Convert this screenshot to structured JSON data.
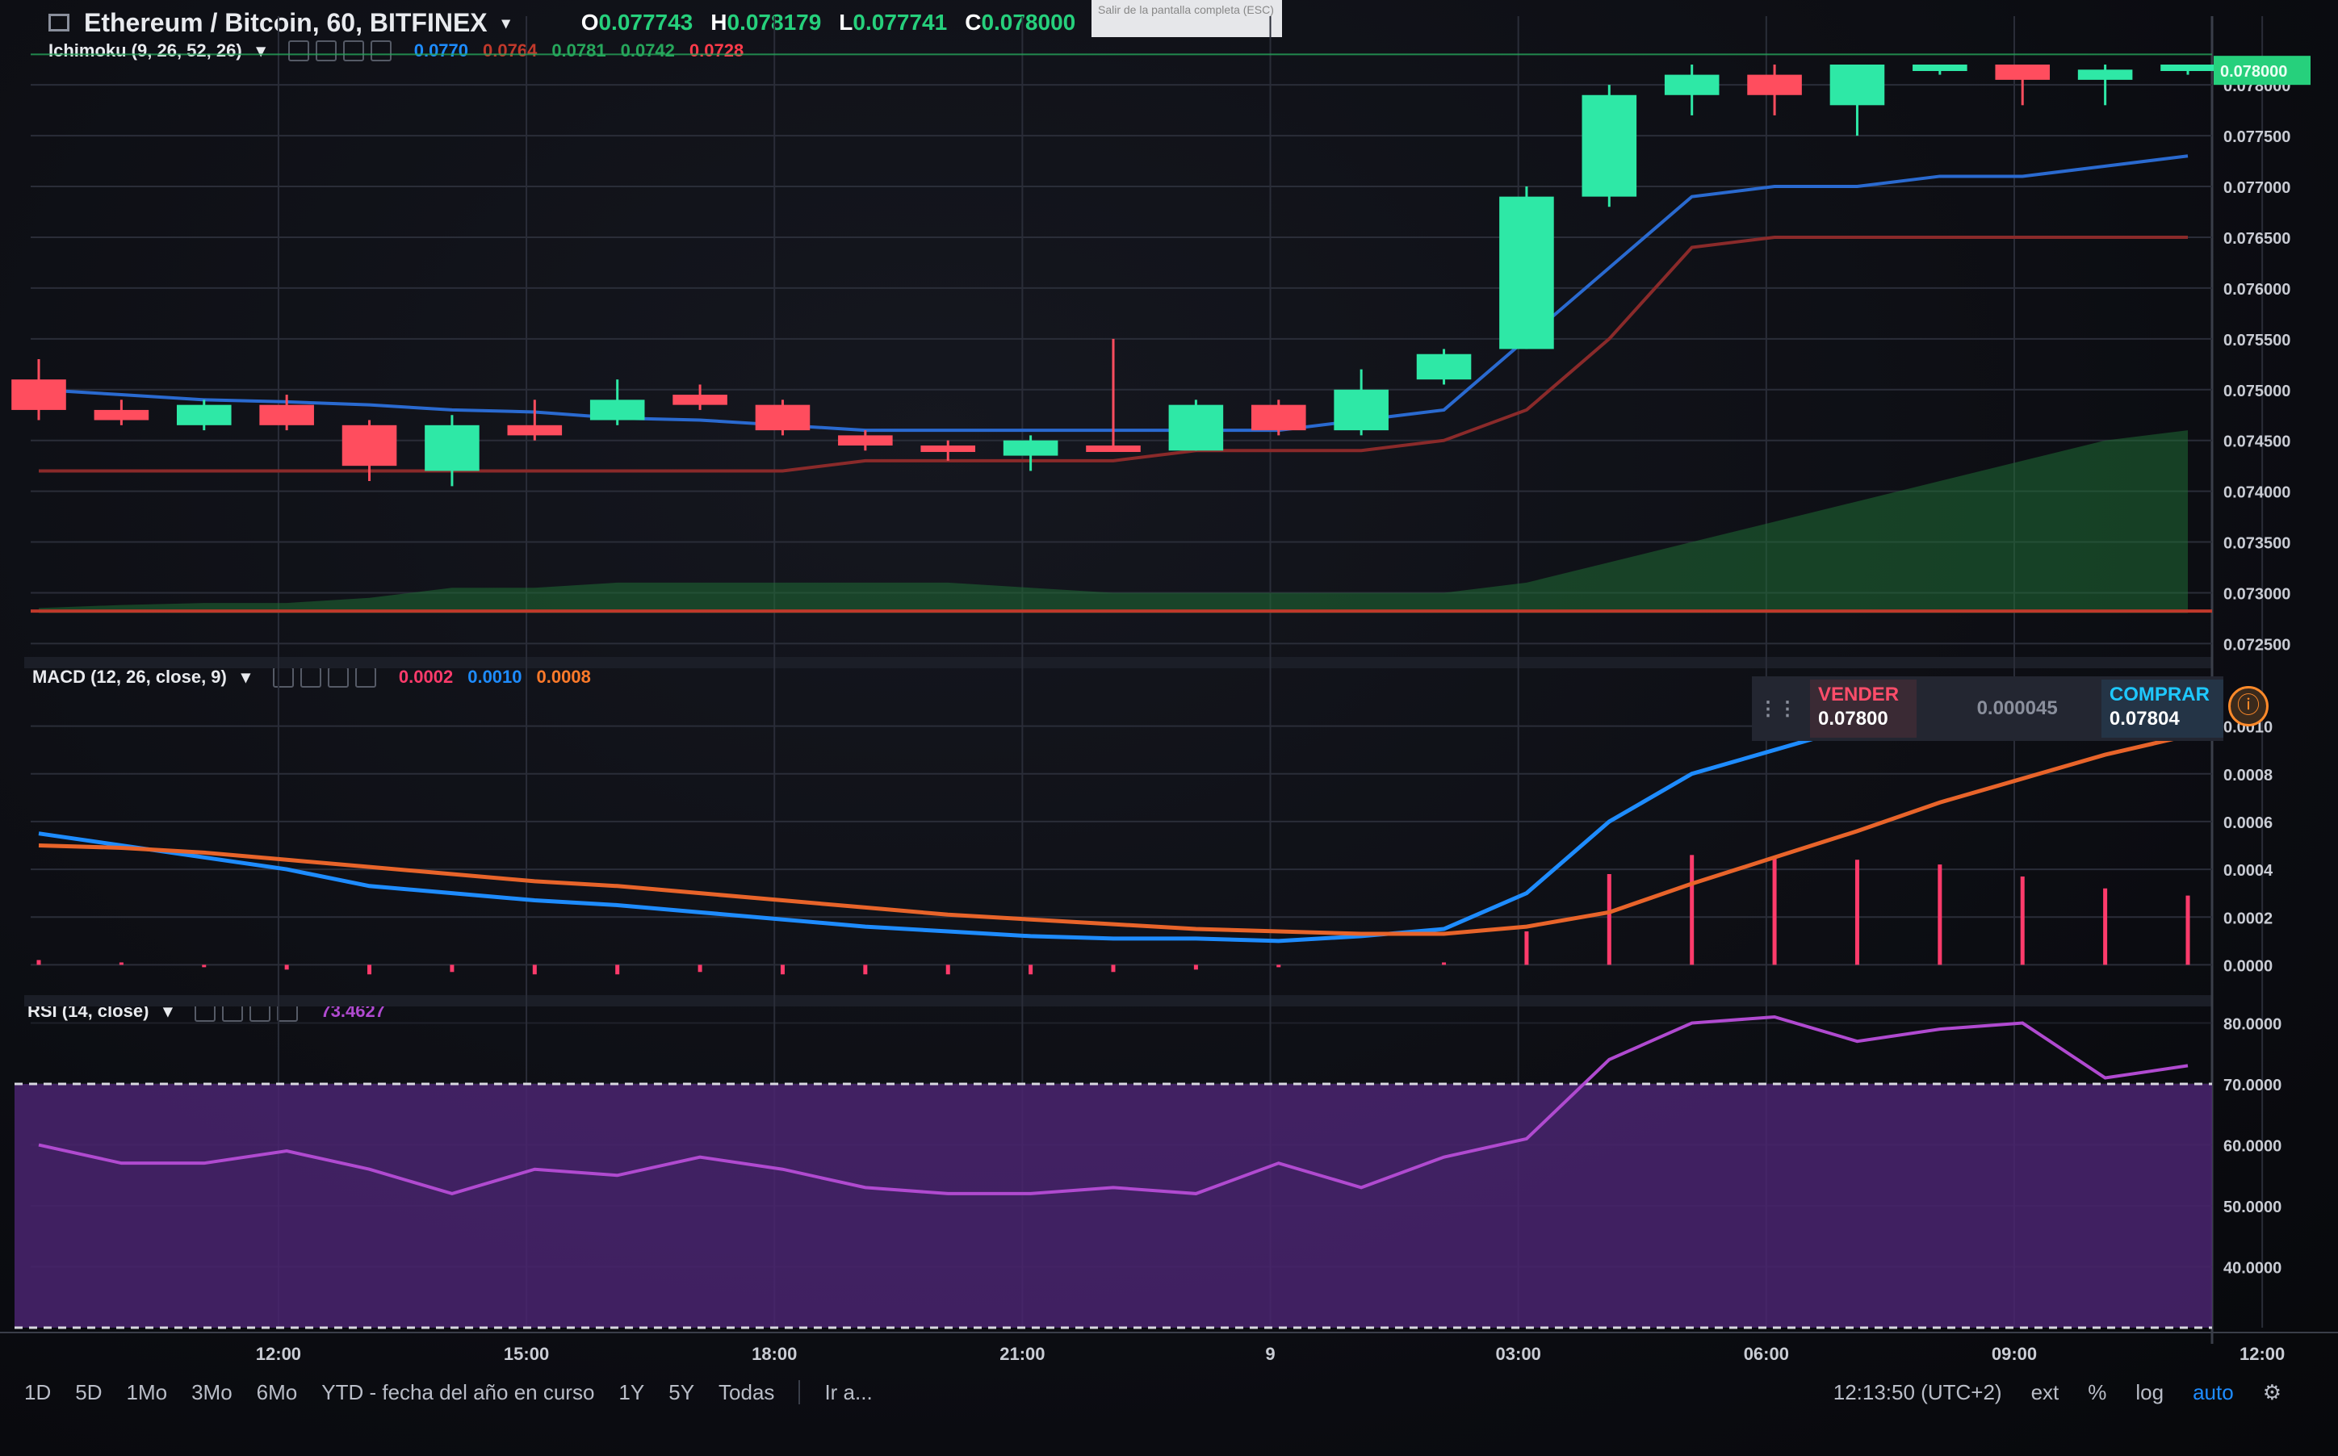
{
  "header": {
    "symbol_title": "Ethereum / Bitcoin, 60, BITFINEX",
    "ohlc": [
      {
        "key": "O",
        "value": "0.077743"
      },
      {
        "key": "H",
        "value": "0.078179"
      },
      {
        "key": "L",
        "value": "0.077741"
      },
      {
        "key": "C",
        "value": "0.078000"
      }
    ],
    "tooltip_text": "Salir de la pantalla completa (ESC)"
  },
  "ichimoku": {
    "label": "Ichimoku (9, 26, 52, 26)",
    "values": [
      {
        "text": "0.0770",
        "color": "#1e8cff"
      },
      {
        "text": "0.0764",
        "color": "#c0392b"
      },
      {
        "text": "0.0781",
        "color": "#26a65b"
      },
      {
        "text": "0.0742",
        "color": "#26a65b"
      },
      {
        "text": "0.0728",
        "color": "#ff3b4a"
      }
    ]
  },
  "macd": {
    "label": "MACD (12, 26, close, 9)",
    "values": [
      {
        "text": "0.0002",
        "color": "#ff3b6b"
      },
      {
        "text": "0.0010",
        "color": "#1e8cff"
      },
      {
        "text": "0.0008",
        "color": "#ff7a2a"
      }
    ]
  },
  "rsi": {
    "label": "RSI (14, close)",
    "value": "73.4627",
    "value_color": "#b04ad0"
  },
  "trade_panel": {
    "sell_label": "VENDER",
    "sell_price": "0.07800",
    "spread": "0.000045",
    "buy_label": "COMPRAR",
    "buy_price": "0.07804"
  },
  "toolbar": {
    "ranges": [
      "1D",
      "5D",
      "1Mo",
      "3Mo",
      "6Mo",
      "YTD - fecha del año en curso",
      "1Y",
      "5Y",
      "Todas"
    ],
    "goto": "Ir a...",
    "clock": "12:13:50 (UTC+2)",
    "right_buttons": [
      "ext",
      "%",
      "log",
      "auto"
    ],
    "active_button": "auto"
  },
  "colors": {
    "up": "#2ee8a6",
    "down": "#ff4d5e",
    "tenkan": "#2a6ad0",
    "kijun": "#8a2a2a",
    "cloud": "#1f6b35",
    "macd_line": "#1e8cff",
    "signal_line": "#e8642a",
    "histogram": "#ff3b6b",
    "rsi_line": "#b04ad0",
    "rsi_fill": "#4a2470"
  },
  "chart_data": [
    {
      "type": "candlestick",
      "title": "Ethereum / Bitcoin, 60, BITFINEX",
      "x_tick_labels": [
        "12:00",
        "15:00",
        "18:00",
        "21:00",
        "9",
        "03:00",
        "06:00",
        "09:00",
        "12:00"
      ],
      "y_tick_labels": [
        "0.078000",
        "0.077500",
        "0.077000",
        "0.076500",
        "0.076000",
        "0.075500",
        "0.075000",
        "0.074500",
        "0.074000",
        "0.073500",
        "0.073000",
        "0.072500"
      ],
      "ylim": [
        0.0724,
        0.0782
      ],
      "current_price_label": "0.078000",
      "candles": [
        {
          "o": 0.0751,
          "h": 0.0753,
          "l": 0.0747,
          "c": 0.0748
        },
        {
          "o": 0.0748,
          "h": 0.0749,
          "l": 0.07465,
          "c": 0.0747
        },
        {
          "o": 0.07465,
          "h": 0.0749,
          "l": 0.0746,
          "c": 0.07485
        },
        {
          "o": 0.07485,
          "h": 0.07495,
          "l": 0.0746,
          "c": 0.07465
        },
        {
          "o": 0.07465,
          "h": 0.0747,
          "l": 0.0741,
          "c": 0.07425
        },
        {
          "o": 0.0742,
          "h": 0.07475,
          "l": 0.07405,
          "c": 0.07465
        },
        {
          "o": 0.07465,
          "h": 0.0749,
          "l": 0.0745,
          "c": 0.07455
        },
        {
          "o": 0.0747,
          "h": 0.0751,
          "l": 0.07465,
          "c": 0.0749
        },
        {
          "o": 0.07495,
          "h": 0.07505,
          "l": 0.0748,
          "c": 0.07485
        },
        {
          "o": 0.07485,
          "h": 0.0749,
          "l": 0.07455,
          "c": 0.0746
        },
        {
          "o": 0.07455,
          "h": 0.0746,
          "l": 0.0744,
          "c": 0.07445
        },
        {
          "o": 0.07445,
          "h": 0.0745,
          "l": 0.0743,
          "c": 0.0744
        },
        {
          "o": 0.07435,
          "h": 0.07455,
          "l": 0.0742,
          "c": 0.0745
        },
        {
          "o": 0.07445,
          "h": 0.0755,
          "l": 0.0744,
          "c": 0.0744
        },
        {
          "o": 0.0744,
          "h": 0.0749,
          "l": 0.0744,
          "c": 0.07485
        },
        {
          "o": 0.07485,
          "h": 0.0749,
          "l": 0.07455,
          "c": 0.0746
        },
        {
          "o": 0.0746,
          "h": 0.0752,
          "l": 0.07455,
          "c": 0.075
        },
        {
          "o": 0.0751,
          "h": 0.0754,
          "l": 0.07505,
          "c": 0.07535
        },
        {
          "o": 0.0754,
          "h": 0.077,
          "l": 0.0754,
          "c": 0.0769
        },
        {
          "o": 0.0769,
          "h": 0.078,
          "l": 0.0768,
          "c": 0.0779
        },
        {
          "o": 0.0779,
          "h": 0.0783,
          "l": 0.0777,
          "c": 0.0781
        },
        {
          "o": 0.0781,
          "h": 0.0784,
          "l": 0.0777,
          "c": 0.0779
        },
        {
          "o": 0.0778,
          "h": 0.0783,
          "l": 0.0775,
          "c": 0.07825
        },
        {
          "o": 0.0783,
          "h": 0.0788,
          "l": 0.0781,
          "c": 0.07865
        },
        {
          "o": 0.07865,
          "h": 0.0787,
          "l": 0.0778,
          "c": 0.07805
        },
        {
          "o": 0.07805,
          "h": 0.0783,
          "l": 0.0778,
          "c": 0.07815
        },
        {
          "o": 0.0782,
          "h": 0.0786,
          "l": 0.0781,
          "c": 0.0785
        }
      ]
    },
    {
      "type": "line",
      "title": "MACD (12, 26, close, 9)",
      "y_tick_labels": [
        "0.0010",
        "0.0008",
        "0.0006",
        "0.0004",
        "0.0002",
        "0.0000"
      ],
      "ylim": [
        -0.0001,
        0.0011
      ],
      "series": [
        {
          "name": "MACD",
          "values": [
            0.00055,
            0.0005,
            0.00045,
            0.0004,
            0.00033,
            0.0003,
            0.00027,
            0.00025,
            0.00022,
            0.00019,
            0.00016,
            0.00014,
            0.00012,
            0.00011,
            0.00011,
            0.0001,
            0.00012,
            0.00015,
            0.0003,
            0.0006,
            0.0008,
            0.0009,
            0.001,
            0.0011,
            0.00115,
            0.0012,
            0.00125
          ]
        },
        {
          "name": "Signal",
          "values": [
            0.0005,
            0.00049,
            0.00047,
            0.00044,
            0.00041,
            0.00038,
            0.00035,
            0.00033,
            0.0003,
            0.00027,
            0.00024,
            0.00021,
            0.00019,
            0.00017,
            0.00015,
            0.00014,
            0.00013,
            0.00013,
            0.00016,
            0.00022,
            0.00034,
            0.00045,
            0.00056,
            0.00068,
            0.00078,
            0.00088,
            0.00096
          ]
        },
        {
          "name": "Histogram",
          "values": [
            2e-05,
            1e-05,
            -1e-05,
            -2e-05,
            -4e-05,
            -3e-05,
            -4e-05,
            -4e-05,
            -3e-05,
            -4e-05,
            -4e-05,
            -4e-05,
            -4e-05,
            -3e-05,
            -2e-05,
            -1e-05,
            0.0,
            1e-05,
            0.00014,
            0.00038,
            0.00046,
            0.00045,
            0.00044,
            0.00042,
            0.00037,
            0.00032,
            0.00029
          ]
        }
      ]
    },
    {
      "type": "line",
      "title": "RSI (14, close)",
      "y_tick_labels": [
        "80.0000",
        "70.0000",
        "60.0000",
        "50.0000",
        "40.0000"
      ],
      "ylim": [
        30,
        81
      ],
      "bands": [
        30,
        70
      ],
      "series": [
        {
          "name": "RSI",
          "values": [
            60,
            57,
            57,
            59,
            56,
            52,
            56,
            55,
            58,
            56,
            53,
            52,
            52,
            53,
            52,
            57,
            53,
            58,
            61,
            74,
            80,
            81,
            77,
            79,
            80,
            71,
            73
          ]
        }
      ]
    }
  ]
}
